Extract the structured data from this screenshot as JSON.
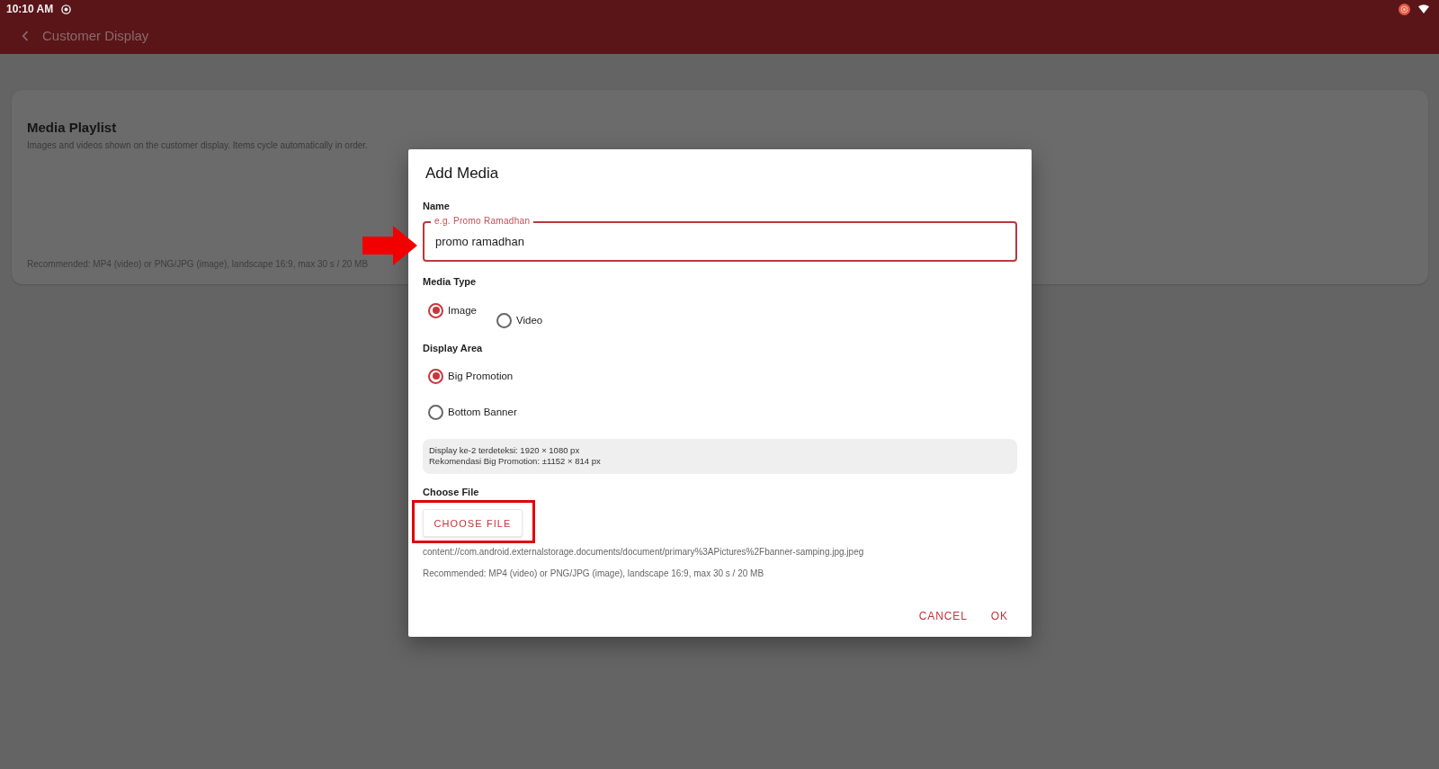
{
  "status_bar": {
    "time": "10:10 AM"
  },
  "app_bar": {
    "title": "Customer Display"
  },
  "playlist_card": {
    "title": "Media Playlist",
    "description": "Images and videos shown on the customer display. Items cycle automatically in order.",
    "note": "Recommended: MP4 (video) or PNG/JPG (image), landscape 16:9, max 30 s / 20 MB"
  },
  "dialog": {
    "title": "Add Media",
    "name_field": {
      "label": "Name",
      "floating_label": "e.g. Promo Ramadhan",
      "value": "promo ramadhan",
      "pointed_at": true
    },
    "media_type": {
      "label": "Media Type",
      "options": [
        {
          "label": "Image",
          "selected": true
        },
        {
          "label": "Video",
          "selected": false
        }
      ]
    },
    "display_area": {
      "label": "Display Area",
      "options": [
        {
          "label": "Big Promotion",
          "selected": true
        },
        {
          "label": "Bottom Banner",
          "selected": false
        }
      ]
    },
    "info_lines": [
      "Display ke-2 terdeteksi: 1920 × 1080 px",
      "Rekomendasi Big Promotion: ±1152 × 814 px"
    ],
    "file": {
      "label": "Choose File",
      "button": "CHOOSE FILE",
      "highlighted": true,
      "path": "content://com.android.externalstorage.documents/document/primary%3APictures%2Fbanner-samping.jpg.jpeg",
      "note": "Recommended: MP4 (video) or PNG/JPG (image), landscape 16:9, max 30 s / 20 MB"
    },
    "actions": [
      {
        "label": "CANCEL"
      },
      {
        "label": "OK"
      }
    ]
  }
}
